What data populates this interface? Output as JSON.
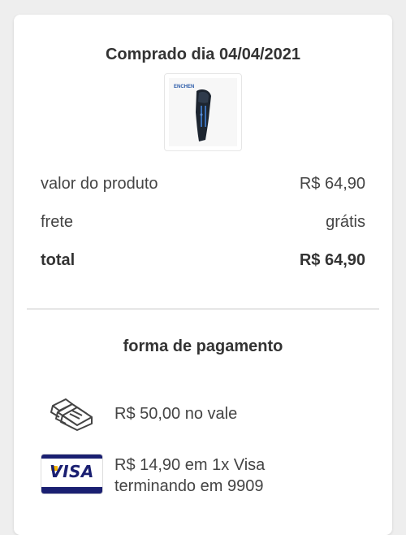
{
  "purchase": {
    "title": "Comprado dia 04/04/2021",
    "product_image_brand": "ENCHEN"
  },
  "summary": {
    "rows": [
      {
        "label": "valor do produto",
        "value": "R$ 64,90"
      },
      {
        "label": "frete",
        "value": "grátis"
      },
      {
        "label": "total",
        "value": "R$ 64,90"
      }
    ]
  },
  "payment": {
    "title": "forma de pagamento",
    "methods": [
      {
        "icon": "voucher-icon",
        "text": "R$ 50,00 no vale"
      },
      {
        "icon": "visa-card-icon",
        "brand": "VISA",
        "text_line1": "R$ 14,90 em 1x Visa",
        "text_line2": "terminando em 9909"
      }
    ]
  },
  "colors": {
    "background": "#eeeeee",
    "card": "#ffffff",
    "text": "#333333",
    "visa_blue": "#1a1f71",
    "visa_gold": "#f7b600"
  }
}
